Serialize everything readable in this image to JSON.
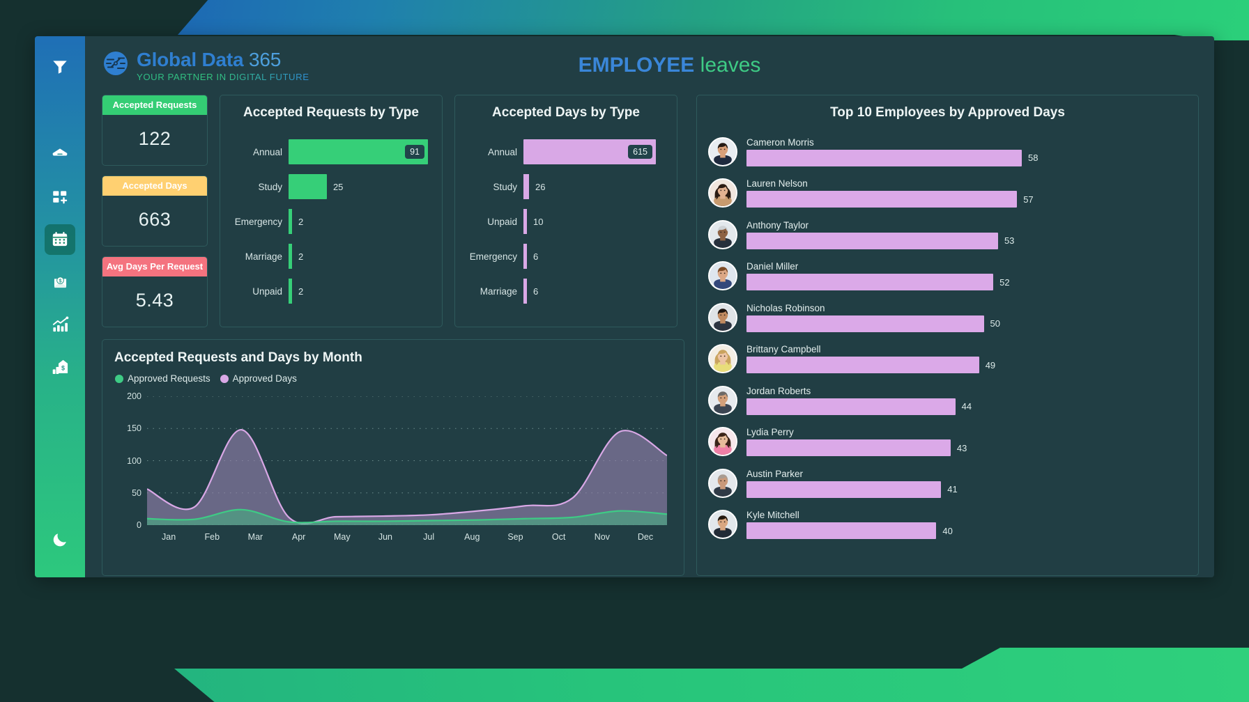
{
  "brand": {
    "name_primary": "Global Data",
    "name_secondary": "365",
    "tagline": "YOUR PARTNER IN DIGITAL FUTURE"
  },
  "header": {
    "title_bold": "EMPLOYEE",
    "title_light": "leaves"
  },
  "sidebar": {
    "items": [
      {
        "icon": "filter-icon",
        "active": false
      },
      {
        "icon": "home-icon",
        "active": false
      },
      {
        "icon": "dashboard-add-icon",
        "active": false
      },
      {
        "icon": "calendar-icon",
        "active": true
      },
      {
        "icon": "payroll-envelope-dollar-icon",
        "active": false
      },
      {
        "icon": "analytics-chart-icon",
        "active": false
      },
      {
        "icon": "finance-building-icon",
        "active": false
      }
    ],
    "theme_toggle_icon": "moon-icon"
  },
  "kpis": [
    {
      "label": "Accepted Requests",
      "value": "122",
      "color": "#34cd74"
    },
    {
      "label": "Accepted Days",
      "value": "663",
      "color": "#ffd071"
    },
    {
      "label": "Avg Days Per Request",
      "value": "5.43",
      "color": "#f4737f"
    }
  ],
  "chart_data": [
    {
      "type": "bar",
      "orientation": "horizontal",
      "title": "Accepted Requests by Type",
      "categories": [
        "Annual",
        "Study",
        "Emergency",
        "Marriage",
        "Unpaid"
      ],
      "values": [
        91,
        25,
        2,
        2,
        2
      ],
      "series_color": "#36cf78",
      "xlabel": "",
      "ylabel": "",
      "xlim": [
        0,
        91
      ],
      "grid": false,
      "label_inside_first_bar": true
    },
    {
      "type": "bar",
      "orientation": "horizontal",
      "title": "Accepted Days by Type",
      "categories": [
        "Annual",
        "Study",
        "Unpaid",
        "Emergency",
        "Marriage"
      ],
      "values": [
        615,
        26,
        10,
        6,
        6
      ],
      "series_color": "#d9a8e6",
      "xlabel": "",
      "ylabel": "",
      "xlim": [
        0,
        615
      ],
      "grid": false,
      "label_inside_first_bar": true
    },
    {
      "type": "area",
      "title": "Accepted Requests and Days by Month",
      "x": [
        "Jan",
        "Feb",
        "Mar",
        "Apr",
        "May",
        "Jun",
        "Jul",
        "Aug",
        "Sep",
        "Oct",
        "Nov",
        "Dec"
      ],
      "series": [
        {
          "name": "Approved Days",
          "color": "#d9a8e6",
          "values": [
            56,
            28,
            148,
            12,
            13,
            14,
            16,
            22,
            30,
            42,
            145,
            108
          ]
        },
        {
          "name": "Approved Requests",
          "color": "#3ecb85",
          "values": [
            10,
            9,
            24,
            5,
            6,
            6,
            7,
            8,
            10,
            12,
            22,
            17
          ]
        }
      ],
      "ylim": [
        0,
        200
      ],
      "yticks": [
        0,
        50,
        100,
        150,
        200
      ],
      "xlabel": "",
      "ylabel": "",
      "grid": true,
      "legend_position": "top-left"
    },
    {
      "type": "bar",
      "orientation": "horizontal",
      "title": "Top 10 Employees by Approved Days",
      "categories": [
        "Cameron Morris",
        "Lauren Nelson",
        "Anthony Taylor",
        "Daniel Miller",
        "Nicholas Robinson",
        "Brittany Campbell",
        "Jordan Roberts",
        "Lydia Perry",
        "Austin Parker",
        "Kyle Mitchell"
      ],
      "values": [
        58,
        57,
        53,
        52,
        50,
        49,
        44,
        43,
        41,
        40
      ],
      "series_color": "#dba9e8",
      "xlim": [
        0,
        58
      ],
      "grid": false
    }
  ],
  "employees": [
    {
      "name": "Cameron Morris",
      "days": "58",
      "avatar": "avatar-male-suit-navy"
    },
    {
      "name": "Lauren Nelson",
      "days": "57",
      "avatar": "avatar-female-long-hair"
    },
    {
      "name": "Anthony Taylor",
      "days": "53",
      "avatar": "avatar-male-grey-hair"
    },
    {
      "name": "Daniel Miller",
      "days": "52",
      "avatar": "avatar-male-blue-suit"
    },
    {
      "name": "Nicholas Robinson",
      "days": "50",
      "avatar": "avatar-male-beard"
    },
    {
      "name": "Brittany Campbell",
      "days": "49",
      "avatar": "avatar-female-yellow-top"
    },
    {
      "name": "Jordan Roberts",
      "days": "44",
      "avatar": "avatar-male-grey-suit"
    },
    {
      "name": "Lydia Perry",
      "days": "43",
      "avatar": "avatar-female-pink-top"
    },
    {
      "name": "Austin Parker",
      "days": "41",
      "avatar": "avatar-male-bald"
    },
    {
      "name": "Kyle Mitchell",
      "days": "40",
      "avatar": "avatar-male-dark-suit"
    }
  ],
  "panels": {
    "requests_by_type_title": "Accepted Requests by Type",
    "days_by_type_title": "Accepted Days by Type",
    "by_month_title": "Accepted Requests and Days by Month",
    "top_employees_title": "Top 10 Employees by Approved Days"
  },
  "colors": {
    "accent_green": "#34cd74",
    "accent_purple": "#d9a8e6",
    "accent_blue": "#3a86d8",
    "panel_bg": "#213e44",
    "panel_border": "#2e5a5c"
  }
}
